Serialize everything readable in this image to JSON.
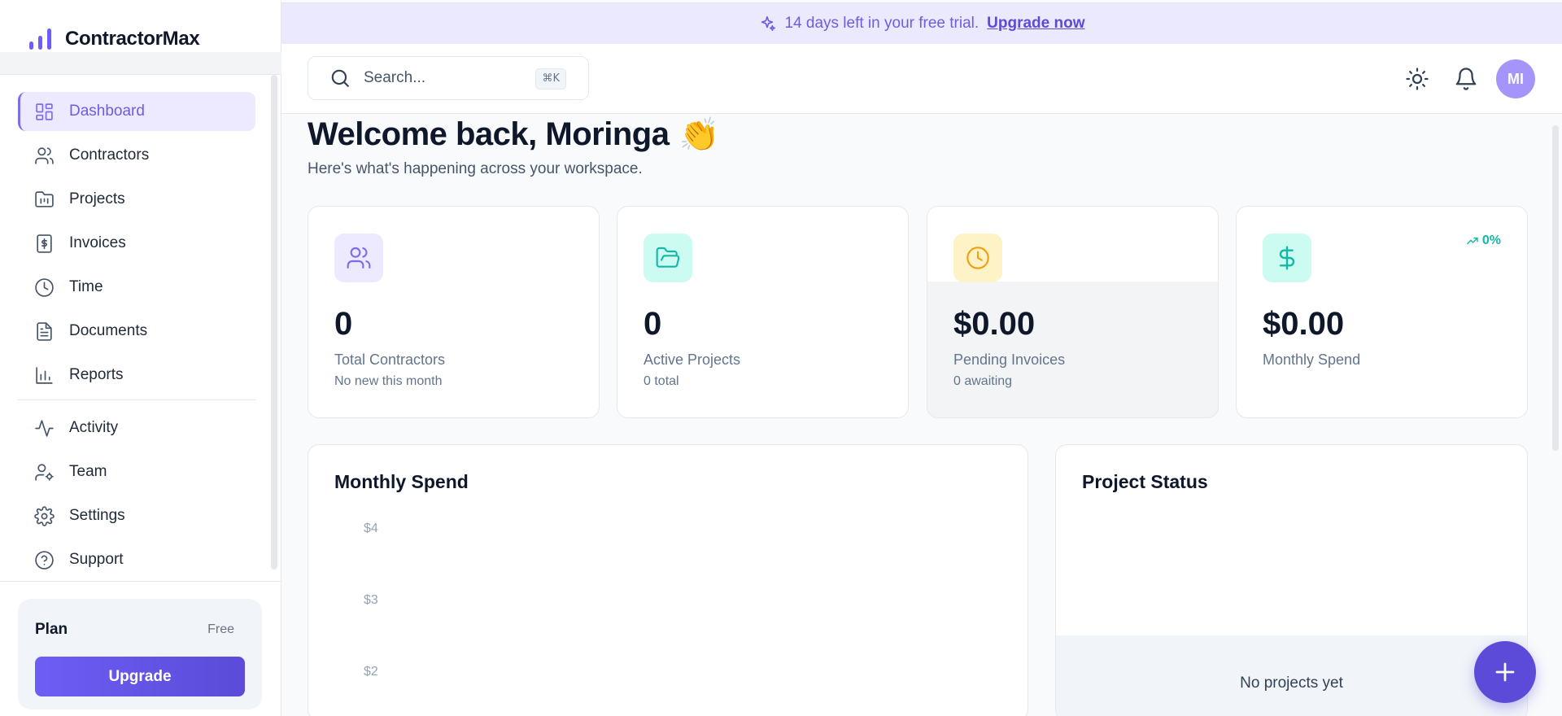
{
  "app": {
    "name": "ContractorMax"
  },
  "banner": {
    "text": "14 days left in your free trial.",
    "link": "Upgrade now"
  },
  "search": {
    "placeholder": "Search...",
    "shortcut": "⌘K"
  },
  "user": {
    "initials": "MI"
  },
  "sidebar": {
    "items": [
      {
        "label": "Dashboard",
        "icon": "dashboard-icon",
        "active": true
      },
      {
        "label": "Contractors",
        "icon": "users-icon"
      },
      {
        "label": "Projects",
        "icon": "folder-icon"
      },
      {
        "label": "Invoices",
        "icon": "invoice-icon"
      },
      {
        "label": "Time",
        "icon": "clock-icon"
      },
      {
        "label": "Documents",
        "icon": "document-icon"
      },
      {
        "label": "Reports",
        "icon": "chart-icon"
      }
    ],
    "items_secondary": [
      {
        "label": "Activity",
        "icon": "activity-icon"
      },
      {
        "label": "Team",
        "icon": "team-icon"
      },
      {
        "label": "Settings",
        "icon": "gear-icon"
      },
      {
        "label": "Support",
        "icon": "help-icon"
      }
    ],
    "plan": {
      "title": "Plan",
      "tier": "Free",
      "button": "Upgrade"
    }
  },
  "welcome": {
    "title": "Welcome back, Moringa",
    "emoji": "👏",
    "subtitle": "Here's what's happening across your workspace."
  },
  "stats": [
    {
      "value": "0",
      "label": "Total Contractors",
      "sub": "No new this month",
      "icon": "users-icon",
      "color": "#7c6cf0"
    },
    {
      "value": "0",
      "label": "Active Projects",
      "sub": "0 total",
      "icon": "folder-open-icon",
      "color": "#14b8a6"
    },
    {
      "value": "$0.00",
      "label": "Pending Invoices",
      "sub": "0 awaiting",
      "icon": "clock-icon",
      "color": "#f59e0b"
    },
    {
      "value": "$0.00",
      "label": "Monthly Spend",
      "trend": "0%",
      "icon": "dollar-icon",
      "color": "#14b8a6"
    }
  ],
  "monthly_spend": {
    "title": "Monthly Spend",
    "y_ticks": [
      "$4",
      "$3",
      "$2"
    ]
  },
  "project_status": {
    "title": "Project Status",
    "empty": "No projects yet"
  }
}
